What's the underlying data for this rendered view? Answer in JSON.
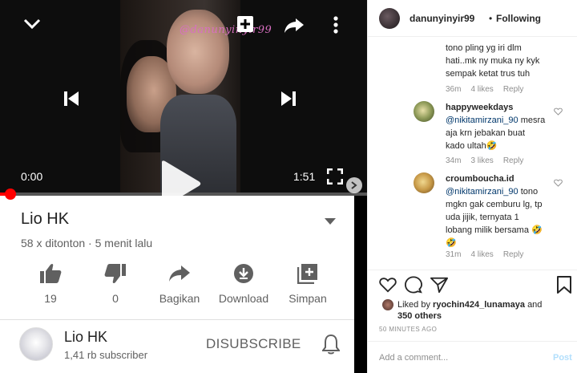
{
  "video": {
    "watermark": "@danunyinyir99",
    "time_current": "0:00",
    "time_duration": "1:51",
    "progress": 0.02
  },
  "card": {
    "title": "Lio HK",
    "meta": "58 x ditonton · 5 menit lalu",
    "actions": [
      {
        "icon": "thumbs-up-icon",
        "label": "19"
      },
      {
        "icon": "thumbs-down-icon",
        "label": "0"
      },
      {
        "icon": "share-icon",
        "label": "Bagikan"
      },
      {
        "icon": "download-icon",
        "label": "Download"
      },
      {
        "icon": "playlist-add-icon",
        "label": "Simpan"
      }
    ],
    "channel_name": "Lio HK",
    "channel_subs": "1,41 rb subscriber",
    "unsubscribe_label": "DISUBSCRIBE"
  },
  "post": {
    "username": "danunyinyir99",
    "dot": "•",
    "follow_state": "Following",
    "comments": [
      {
        "user": "",
        "lines": [
          "tono pling yg iri dlm",
          "hati..mk ny muka ny kyk",
          "sempak ketat trus tuh"
        ],
        "age": "36m",
        "likes": "4 likes",
        "reply": "Reply"
      },
      {
        "user": "happyweekdays",
        "mention": "@nikitamirzani_90",
        "lines": [
          "mesra",
          "aja krn jebakan buat",
          "kado ultah🤣"
        ],
        "age": "34m",
        "likes": "3 likes",
        "reply": "Reply"
      },
      {
        "user": "croumboucha.id",
        "mention": "@nikitamirzani_90",
        "lines": [
          "tono",
          "mgkn gak cemburu lg, tp",
          "uda jijik, ternyata 1",
          "lobang milik bersama 🤣",
          "🤣"
        ],
        "age": "31m",
        "likes": "4 likes",
        "reply": "Reply"
      }
    ],
    "liked_by_prefix": "Liked by",
    "liked_by_user": "ryochin424_lunamaya",
    "liked_by_and": "and",
    "liked_by_others": "350 others",
    "time_ago": "50 MINUTES AGO",
    "add_comment_placeholder": "Add a comment...",
    "post_label": "Post"
  },
  "colors": {
    "progress": "#ff0000",
    "link": "#00376b",
    "post_disabled": "#b2dffc"
  }
}
